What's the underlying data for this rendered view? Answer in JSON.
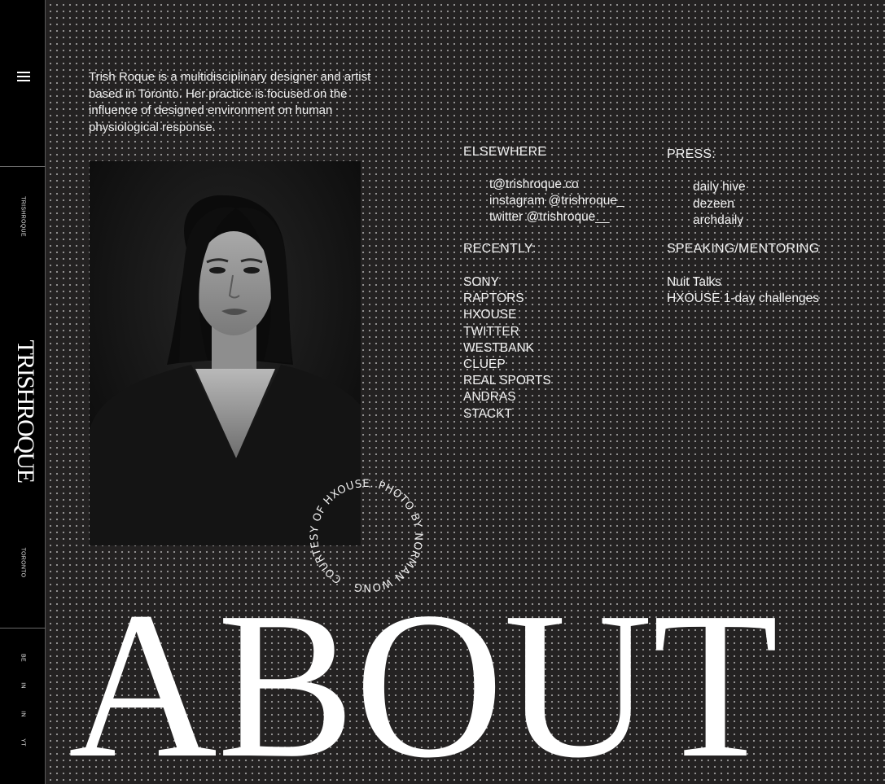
{
  "sidebar": {
    "menu_icon": "hamburger-menu-icon",
    "small_name": "TRISHROQUE",
    "brand": "TRISHROQUE",
    "location": "TORONTO",
    "social": [
      "BE",
      "IN",
      "IN",
      "YT"
    ]
  },
  "intro": "Trish Roque is a multidisciplinary designer and artist based in Toronto. Her practice is focused on the influence of designed environment on human physiological response.",
  "photo_credit": "COURTESY OF HXOUSE. PHOTO BY NORMAN WONG",
  "elsewhere": {
    "heading": "ELSEWHERE",
    "items": [
      "t@trishroque.co",
      "instagram @trishroque_",
      "twitter @trishroque__"
    ]
  },
  "press": {
    "heading": "PRESS:",
    "items": [
      "daily hive",
      "dezeen",
      "archdaily"
    ]
  },
  "recently": {
    "heading": "RECENTLY:",
    "items": [
      "SONY",
      "RAPTORS",
      "HXOUSE",
      "TWITTER",
      "WESTBANK",
      "CLUEP",
      "REAL SPORTS",
      "ANDRAS",
      "STACKT"
    ]
  },
  "speaking": {
    "heading": "SPEAKING/MENTORING",
    "items": [
      "Nuit Talks",
      "HXOUSE 1-day challenges"
    ]
  },
  "page_title": "ABOUT",
  "colors": {
    "background": "#242222",
    "sidebar": "#000000",
    "text": "#f2f2f2"
  }
}
